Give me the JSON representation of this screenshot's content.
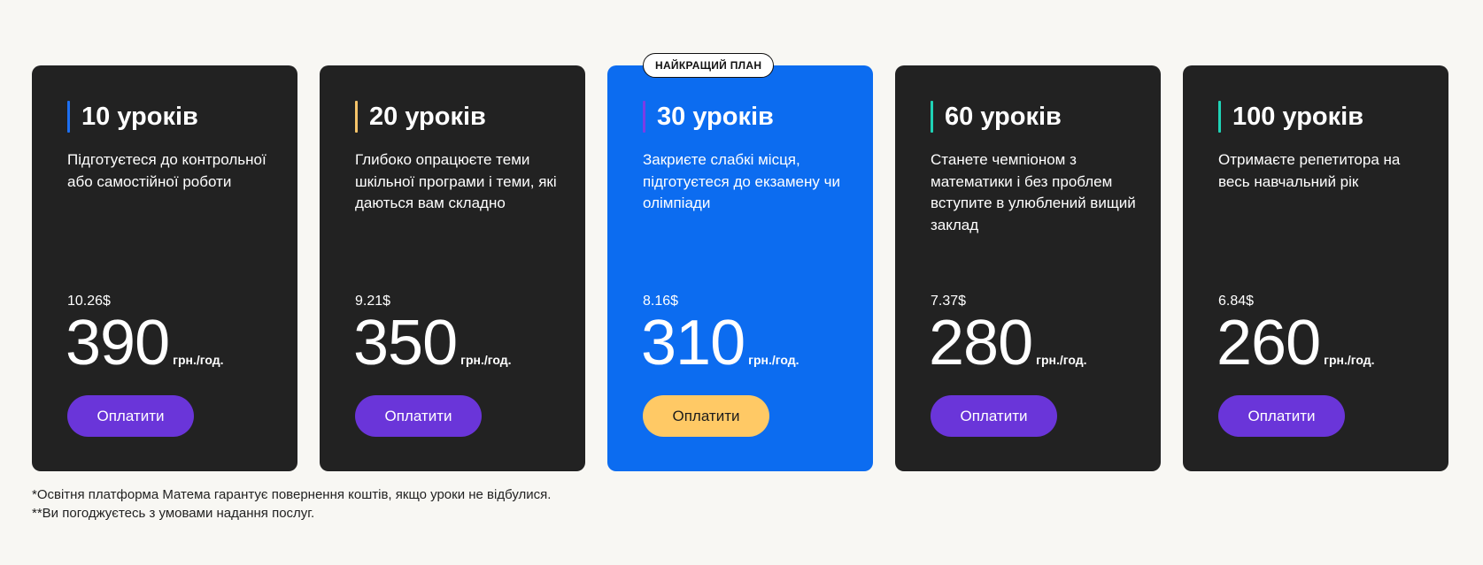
{
  "colors": {
    "page_bg": "#f8f7f3",
    "card_bg": "#222222",
    "featured_bg": "#0c6cf0",
    "button": "#6a35d9",
    "featured_button": "#ffc965"
  },
  "plans": [
    {
      "title": "10 уроків",
      "accent": "#1d6ff2",
      "description": "Підготуєтеся до контрольної або самостійної роботи",
      "usd": "10.26$",
      "price": "390",
      "unit": "грн./год.",
      "button": "Оплатити"
    },
    {
      "title": "20 уроків",
      "accent": "#f6c46a",
      "description": "Глибоко опрацюєте теми шкільної програми і теми, які даються вам складно",
      "usd": "9.21$",
      "price": "350",
      "unit": "грн./год.",
      "button": "Оплатити"
    },
    {
      "title": "30 уроків",
      "accent": "#7b3ce6",
      "badge": "НАЙКРАЩИЙ ПЛАН",
      "description": "Закриєте слабкі місця, підготуєтеся до екзамену чи олімпіади",
      "usd": "8.16$",
      "price": "310",
      "unit": "грн./год.",
      "button": "Оплатити"
    },
    {
      "title": "60 уроків",
      "accent": "#1fd3b6",
      "description": "Станете чемпіоном з математики і без проблем вступите в улюблений вищий заклад",
      "usd": "7.37$",
      "price": "280",
      "unit": "грн./год.",
      "button": "Оплатити"
    },
    {
      "title": "100 уроків",
      "accent": "#1fd3b6",
      "description": "Отримаєте репетитора на весь навчальний рік",
      "usd": "6.84$",
      "price": "260",
      "unit": "грн./год.",
      "button": "Оплатити"
    }
  ],
  "notes": {
    "refund": "*Освітня платформа Матема гарантує повернення коштів, якщо уроки не відбулися.",
    "terms": "**Ви погоджуєтесь з умовами надання послуг."
  }
}
